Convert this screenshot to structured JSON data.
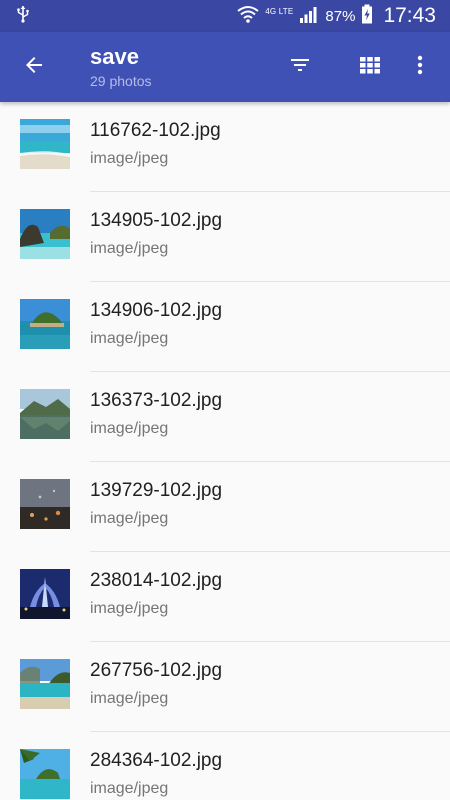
{
  "status_bar": {
    "usb_icon": "usb-icon",
    "network_label": "4G LTE",
    "battery_percent": "87%",
    "time": "17:43"
  },
  "toolbar": {
    "title": "save",
    "subtitle": "29 photos",
    "back_icon": "arrow-back-icon",
    "filter_icon": "filter-icon",
    "grid_icon": "grid-view-icon",
    "more_icon": "more-vert-icon"
  },
  "files": [
    {
      "name": "116762-102.jpg",
      "type": "image/jpeg"
    },
    {
      "name": "134905-102.jpg",
      "type": "image/jpeg"
    },
    {
      "name": "134906-102.jpg",
      "type": "image/jpeg"
    },
    {
      "name": "136373-102.jpg",
      "type": "image/jpeg"
    },
    {
      "name": "139729-102.jpg",
      "type": "image/jpeg"
    },
    {
      "name": "238014-102.jpg",
      "type": "image/jpeg"
    },
    {
      "name": "267756-102.jpg",
      "type": "image/jpeg"
    },
    {
      "name": "284364-102.jpg",
      "type": "image/jpeg"
    }
  ],
  "colors": {
    "status_bar": "#3a48a4",
    "toolbar": "#3f51b5",
    "background": "#fafafa"
  }
}
